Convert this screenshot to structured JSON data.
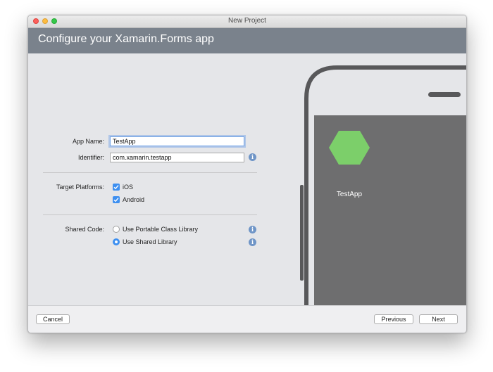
{
  "window": {
    "title": "New Project"
  },
  "header": {
    "title": "Configure your Xamarin.Forms app"
  },
  "form": {
    "app_name": {
      "label": "App Name:",
      "value": "TestApp"
    },
    "identifier": {
      "label": "Identifier:",
      "value": "com.xamarin.testapp"
    },
    "target_platforms": {
      "label": "Target Platforms:",
      "options": [
        {
          "label": "iOS",
          "checked": true
        },
        {
          "label": "Android",
          "checked": true
        }
      ]
    },
    "shared_code": {
      "label": "Shared Code:",
      "options": [
        {
          "label": "Use Portable Class Library",
          "selected": false
        },
        {
          "label": "Use Shared Library",
          "selected": true
        }
      ]
    }
  },
  "preview": {
    "app_label": "TestApp",
    "icon_color": "#7ccf6a",
    "screen_color": "#6e6e6f",
    "frame_color": "#58585a"
  },
  "footer": {
    "cancel": "Cancel",
    "previous": "Previous",
    "next": "Next"
  },
  "colors": {
    "header": "#7a828c",
    "accent": "#3d8ff0"
  }
}
